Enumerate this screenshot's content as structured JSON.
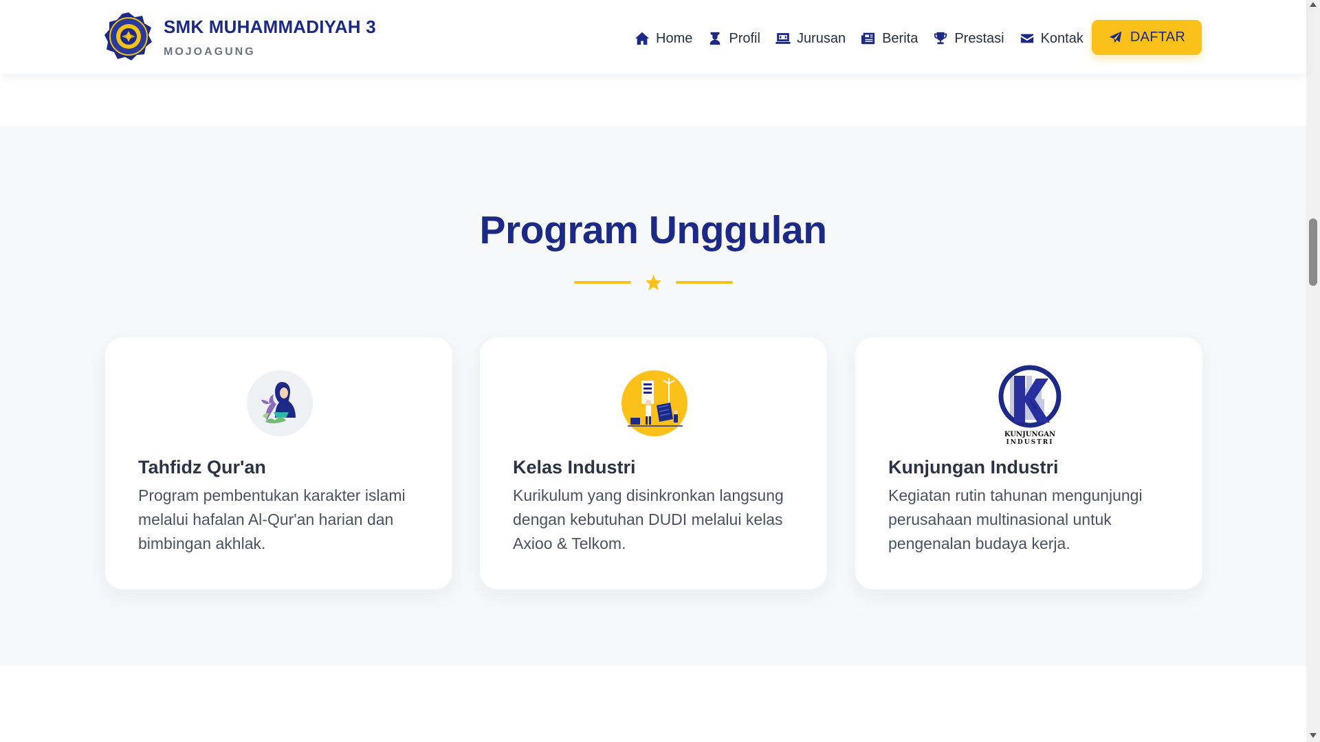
{
  "header": {
    "brand_name": "SMK MUHAMMADIYAH 3",
    "brand_sub": "MOJOAGUNG",
    "nav": [
      {
        "label": "Home",
        "icon": "home-icon"
      },
      {
        "label": "Profil",
        "icon": "user-graduate-icon"
      },
      {
        "label": "Jurusan",
        "icon": "laptop-code-icon"
      },
      {
        "label": "Berita",
        "icon": "newspaper-icon"
      },
      {
        "label": "Prestasi",
        "icon": "trophy-icon"
      },
      {
        "label": "Kontak",
        "icon": "envelope-icon"
      }
    ],
    "cta_label": "DAFTAR",
    "cta_icon": "paper-plane-icon"
  },
  "section": {
    "title": "Program Unggulan",
    "cards": [
      {
        "title": "Tahfidz Qur'an",
        "description": "Program pembentukan karakter islami melalui hafalan Al-Qur'an harian dan bimbingan akhlak.",
        "icon": "quran-reader-illustration"
      },
      {
        "title": "Kelas Industri",
        "description": "Kurikulum yang disinkronkan langsung dengan kebutuhan DUDI melalui kelas Axioo & Telkom.",
        "icon": "industry-workers-illustration"
      },
      {
        "title": "Kunjungan Industri",
        "description": "Kegiatan rutin tahunan mengunjungi perusahaan multinasional untuk pengenalan budaya kerja.",
        "icon": "kunjungan-industri-logo",
        "logo_text": "KUNJUNGAN INDUSTRI"
      }
    ]
  },
  "colors": {
    "primary": "#1c2a85",
    "accent": "#fbc11a",
    "section_bg": "#f7f8fa"
  }
}
